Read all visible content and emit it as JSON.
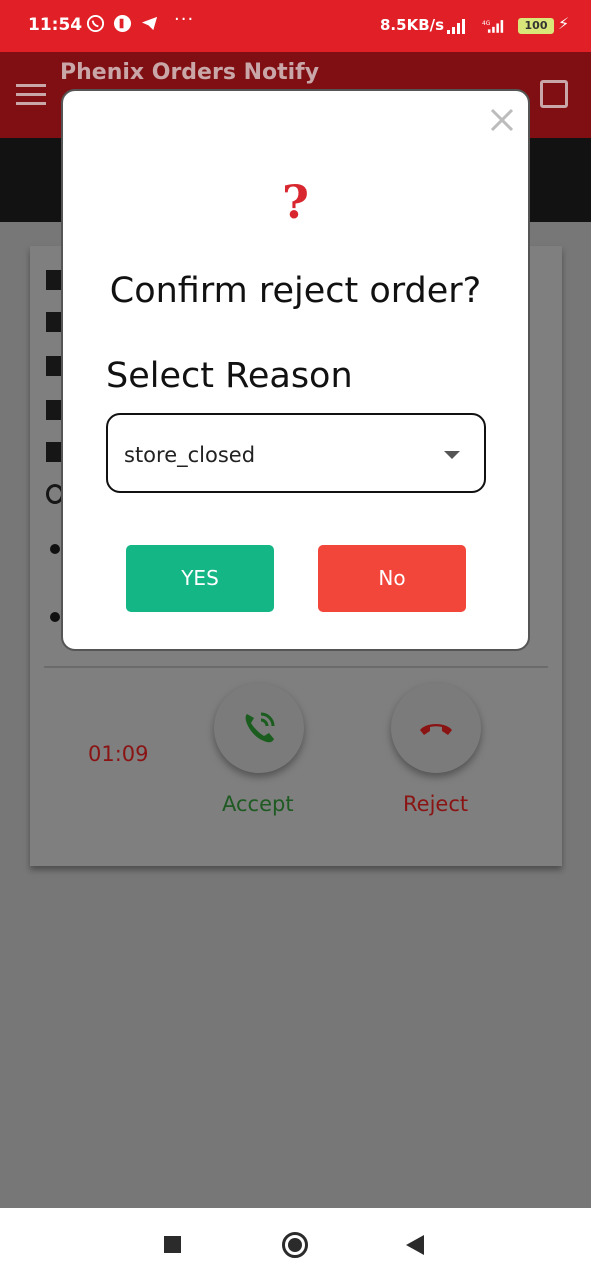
{
  "status_bar": {
    "time": "11:54",
    "overflow": "···",
    "net_speed": "8.5KB/s",
    "battery": "100"
  },
  "app_bar": {
    "title": "Phenix Orders Notify"
  },
  "order_card": {
    "timer": "01:09",
    "accept_label": "Accept",
    "reject_label": "Reject"
  },
  "dialog": {
    "icon": "?",
    "title": "Confirm reject order?",
    "reason_label": "Select Reason",
    "reason_value": "store_closed",
    "yes_label": "YES",
    "no_label": "No"
  },
  "colors": {
    "primary_red": "#e01f26",
    "yes_green": "#14b686",
    "no_red": "#f3463a",
    "question_red": "#d8272f"
  },
  "icons": {
    "status_left": [
      "whatsapp-icon",
      "app-icon",
      "telegram-icon"
    ],
    "status_right": [
      "signal-icon",
      "signal-4g-icon",
      "battery-icon",
      "charging-icon"
    ],
    "app_bar": [
      "menu-icon",
      "calendar-icon"
    ],
    "dialog": [
      "close-icon",
      "question-icon",
      "dropdown-arrow-icon"
    ],
    "card": [
      "phone-accept-icon",
      "phone-reject-icon"
    ],
    "nav": [
      "recents-icon",
      "home-icon",
      "back-icon"
    ]
  }
}
